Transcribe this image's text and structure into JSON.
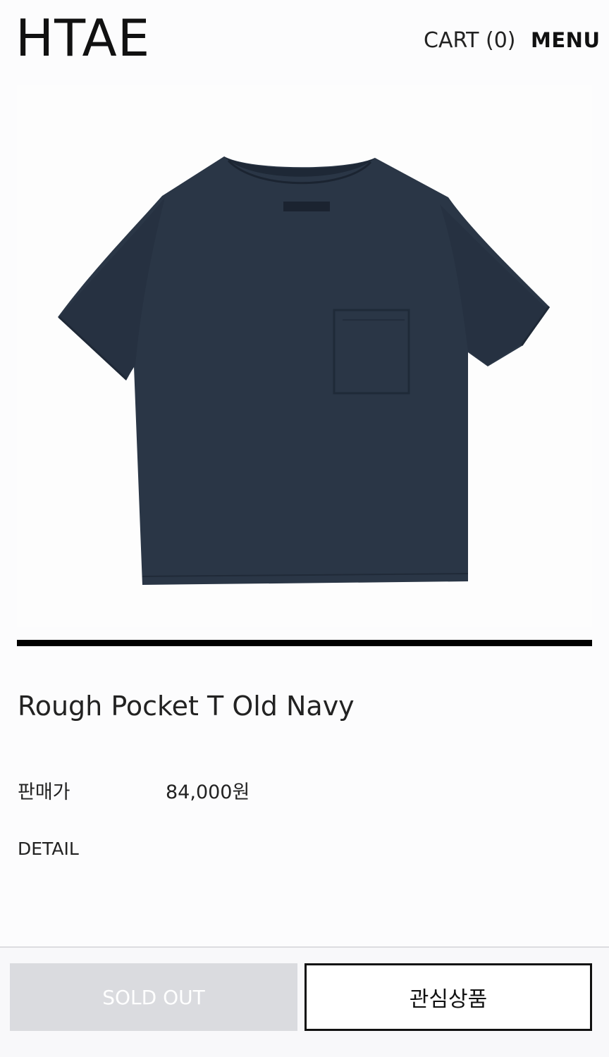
{
  "header": {
    "logo": "HTAE",
    "cart_label": "CART (0)",
    "menu_label": "MENU"
  },
  "product": {
    "image_subject": "navy t-shirt",
    "name": "Rough Pocket T Old Navy",
    "price_label": "판매가",
    "price_value": "84,000원",
    "detail_label": "DETAIL"
  },
  "actions": {
    "sold_out_label": "SOLD OUT",
    "wishlist_label": "관심상품"
  },
  "colors": {
    "shirt": "#2a3646",
    "accent": "#000000",
    "sold_out_bg": "#dadbdf"
  }
}
